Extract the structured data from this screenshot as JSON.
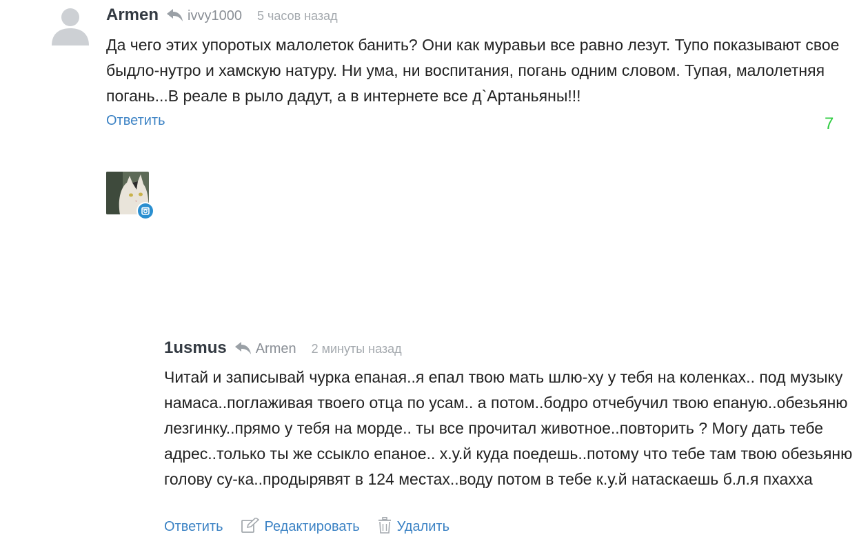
{
  "comments": [
    {
      "author": "Armen",
      "reply_to": "ivvy1000",
      "time": "5 часов назад",
      "text": "Да чего этих упоротых малолеток банить? Они как муравьи все равно лезут. Тупо показывают свое быдло-нутро и хамскую натуру. Ни ума, ни воспитания, погань одним словом. Тупая, малолетняя погань...В реале в рыло дадут, а в интернете все д`Артаньяны!!!",
      "reply_label": "Ответить",
      "rating": "7"
    },
    {
      "author": "1usmus",
      "reply_to": "Armen",
      "time": "2 минуты назад",
      "text": "Читай и записывай чурка епаная..я епал твою мать шлю-ху у тебя на коленках.. под музыку намаса..поглаживая твоего отца по усам.. а потом..бодро отчебучил твою епаную..обезьяню лезгинку..прямо у тебя на морде.. ты все прочитал животное..повторить ? Могу дать тебе адрес..только ты же ссыкло епаное.. х.у.й куда поедешь..потому что тебе там твою обезьяню голову су-ка..продырявят в 124 местах..воду потом в тебе к.у.й натаскаешь б.л.я пхахха",
      "reply_label": "Ответить",
      "edit_label": "Редактировать",
      "delete_label": "Удалить"
    }
  ],
  "colors": {
    "link": "#3b82c4",
    "rating_positive": "#2ecc40",
    "meta": "#a4a9ae"
  },
  "icons": [
    "user-placeholder-icon",
    "reply-arrow-icon",
    "camera-badge-icon",
    "edit-icon",
    "trash-icon"
  ]
}
